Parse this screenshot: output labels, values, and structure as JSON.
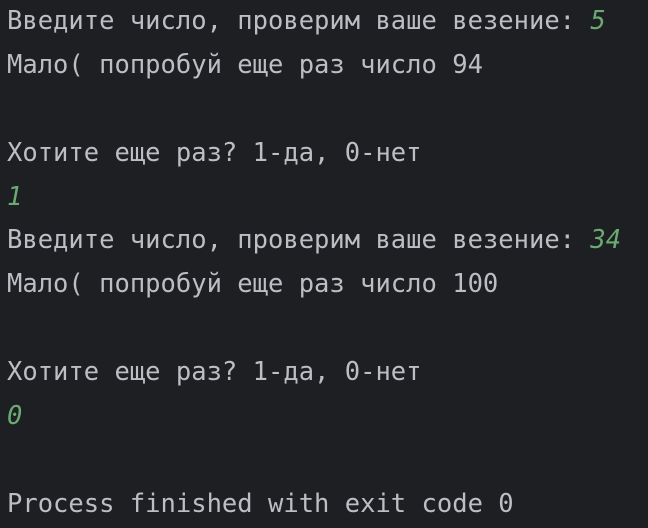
{
  "console": {
    "lines": [
      {
        "text": "Введите число, проверим ваше везение: ",
        "input": "5"
      },
      {
        "text": "Мало( попробуй еще раз число 94"
      },
      {
        "text": ""
      },
      {
        "text": "Хотите еще раз? 1-да, 0-нет"
      },
      {
        "text": "",
        "input": "1"
      },
      {
        "text": "Введите число, проверим ваше везение: ",
        "input": "34"
      },
      {
        "text": "Мало( попробуй еще раз число 100"
      },
      {
        "text": ""
      },
      {
        "text": "Хотите еще раз? 1-да, 0-нет"
      },
      {
        "text": "",
        "input": "0"
      },
      {
        "text": ""
      },
      {
        "text": "Process finished with exit code 0"
      }
    ]
  },
  "colors": {
    "background": "#1e1f22",
    "text": "#bcbec4",
    "user_input": "#6aab73"
  }
}
